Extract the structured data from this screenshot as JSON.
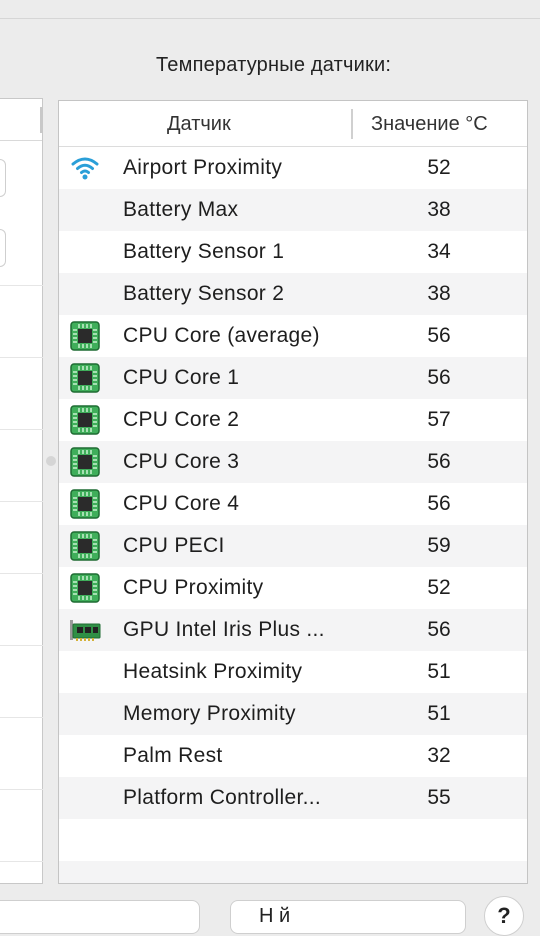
{
  "section_title": "Температурные датчики:",
  "table": {
    "columns": [
      "Датчик",
      "Значение °C"
    ],
    "rows": [
      {
        "icon": "wifi-icon",
        "name": "Airport Proximity",
        "value": "52"
      },
      {
        "icon": "",
        "name": "Battery Max",
        "value": "38"
      },
      {
        "icon": "",
        "name": "Battery Sensor 1",
        "value": "34"
      },
      {
        "icon": "",
        "name": "Battery Sensor 2",
        "value": "38"
      },
      {
        "icon": "chip-icon",
        "name": "CPU Core (average)",
        "value": "56"
      },
      {
        "icon": "chip-icon",
        "name": "CPU Core 1",
        "value": "56"
      },
      {
        "icon": "chip-icon",
        "name": "CPU Core 2",
        "value": "57"
      },
      {
        "icon": "chip-icon",
        "name": "CPU Core 3",
        "value": "56"
      },
      {
        "icon": "chip-icon",
        "name": "CPU Core 4",
        "value": "56"
      },
      {
        "icon": "chip-icon",
        "name": "CPU PECI",
        "value": "59"
      },
      {
        "icon": "chip-icon",
        "name": "CPU Proximity",
        "value": "52"
      },
      {
        "icon": "gpu-card-icon",
        "name": "GPU Intel Iris Plus ...",
        "value": "56"
      },
      {
        "icon": "",
        "name": "Heatsink Proximity",
        "value": "51"
      },
      {
        "icon": "",
        "name": "Memory Proximity",
        "value": "51"
      },
      {
        "icon": "",
        "name": "Palm Rest",
        "value": "32"
      },
      {
        "icon": "",
        "name": "Platform Controller...",
        "value": "55"
      }
    ]
  },
  "buttons": {
    "second_label": "Н         й",
    "help_label": "?"
  },
  "colors": {
    "row_alt": "#f4f4f5",
    "wifi": "#2a9fd8",
    "chip_green": "#3fae5a"
  }
}
